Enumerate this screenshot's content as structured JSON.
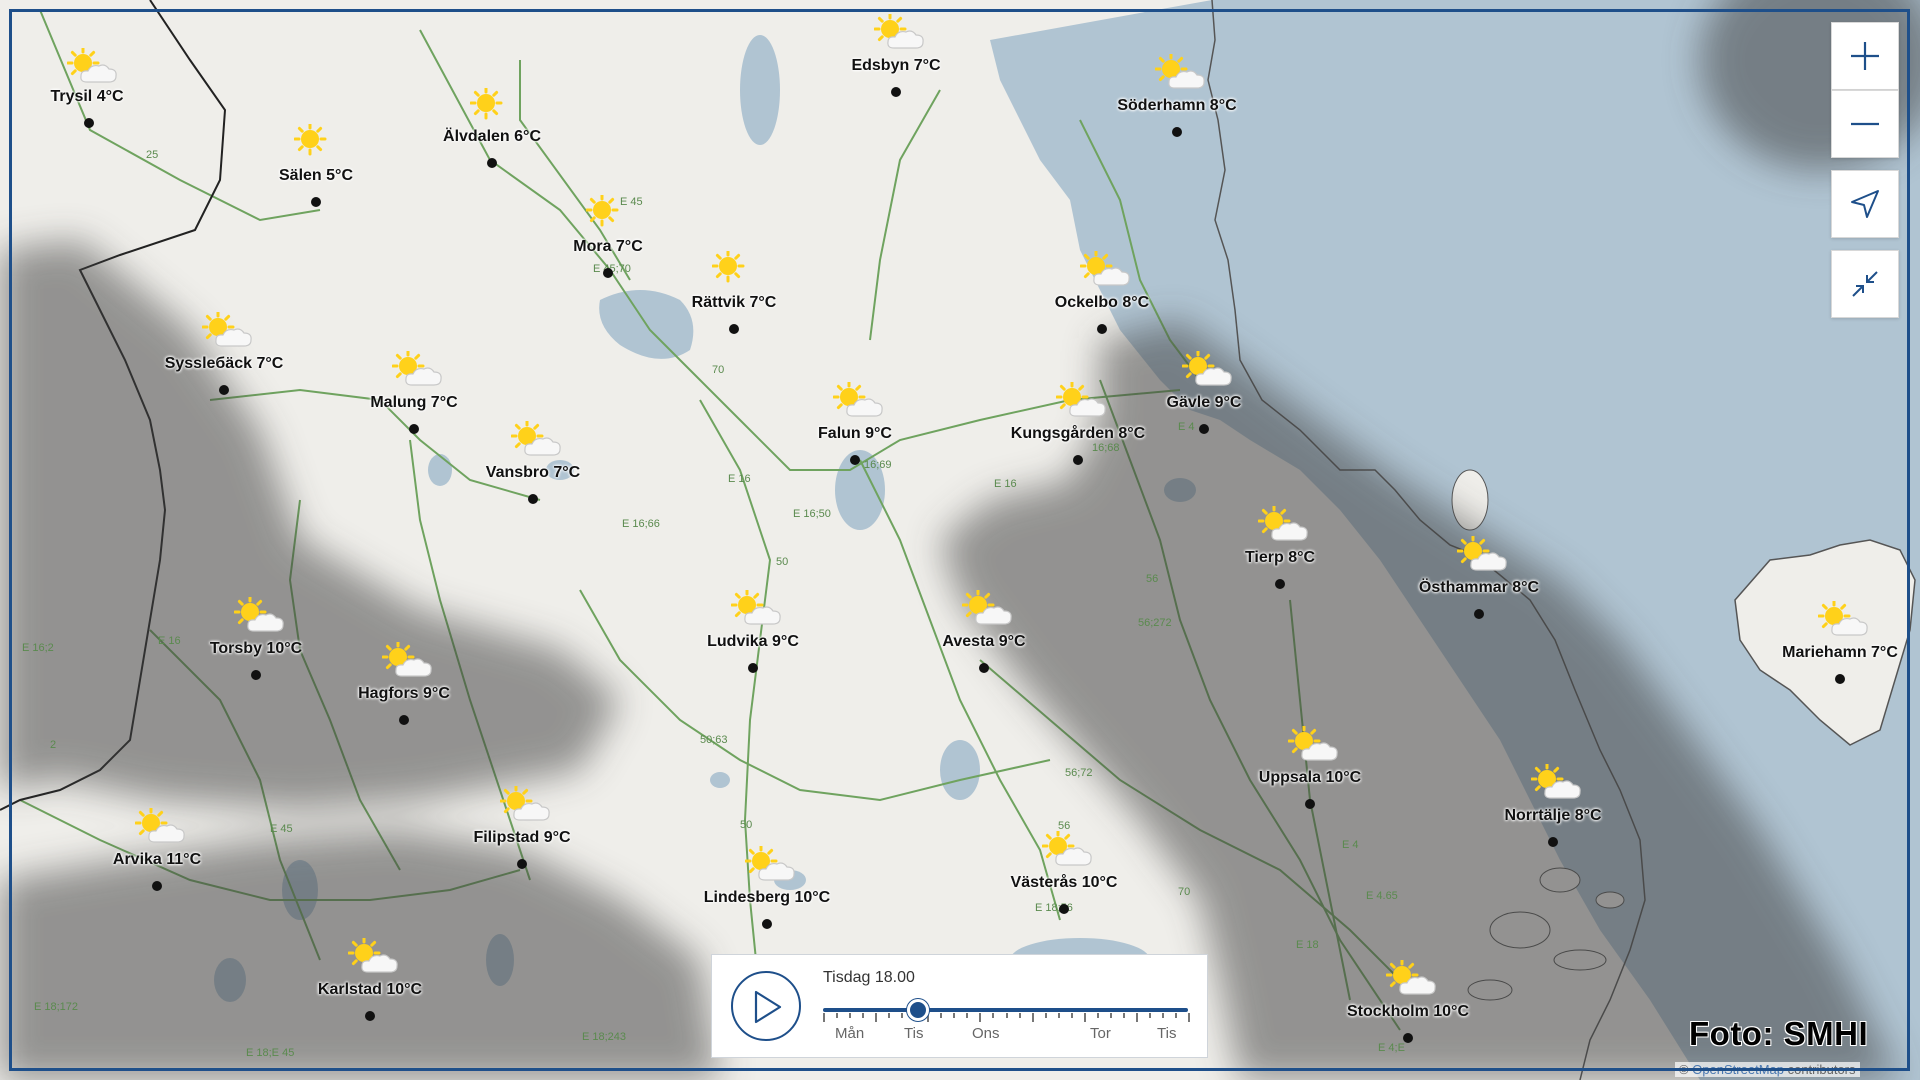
{
  "map": {
    "cities": [
      {
        "id": "trysil",
        "label": "Trysil 4°C",
        "icon": "sun-cloud-icon"
      },
      {
        "id": "alvdalen",
        "label": "Älvdalen 6°C",
        "icon": "sun-icon"
      },
      {
        "id": "salen",
        "label": "Sälen 5°C",
        "icon": "sun-icon"
      },
      {
        "id": "edsbyn",
        "label": "Edsbyn 7°C",
        "icon": "sun-cloud-icon"
      },
      {
        "id": "soderhamn",
        "label": "Söderhamn 8°C",
        "icon": "sun-cloud-icon"
      },
      {
        "id": "mora",
        "label": "Mora 7°C",
        "icon": "sun-icon"
      },
      {
        "id": "rattvik",
        "label": "Rättvik 7°C",
        "icon": "sun-icon"
      },
      {
        "id": "ockelbo",
        "label": "Ockelbo 8°C",
        "icon": "sun-cloud-icon"
      },
      {
        "id": "sysslebeck",
        "label": "Syssleбäck 7°C",
        "icon": "sun-cloud-icon"
      },
      {
        "id": "malung",
        "label": "Malung 7°C",
        "icon": "sun-cloud-icon"
      },
      {
        "id": "gavle",
        "label": "Gävle 9°C",
        "icon": "sun-cloud-icon"
      },
      {
        "id": "falun",
        "label": "Falun 9°C",
        "icon": "sun-cloud-icon"
      },
      {
        "id": "kungsgarden",
        "label": "Kungsgården 8°C",
        "icon": "sun-cloud-icon"
      },
      {
        "id": "vansbro",
        "label": "Vansbro 7°C",
        "icon": "sun-cloud-icon"
      },
      {
        "id": "tierp",
        "label": "Tierp 8°C",
        "icon": "sun-cloud-icon"
      },
      {
        "id": "osthammar",
        "label": "Östhammar 8°C",
        "icon": "sun-cloud-icon"
      },
      {
        "id": "mariehamn",
        "label": "Mariehamn 7°C",
        "icon": "sun-cloud-icon"
      },
      {
        "id": "torsby",
        "label": "Torsby 10°C",
        "icon": "sun-cloud-icon"
      },
      {
        "id": "ludvika",
        "label": "Ludvika 9°C",
        "icon": "sun-cloud-icon"
      },
      {
        "id": "avesta",
        "label": "Avesta 9°C",
        "icon": "sun-cloud-icon"
      },
      {
        "id": "hagfors",
        "label": "Hagfors 9°C",
        "icon": "sun-cloud-icon"
      },
      {
        "id": "uppsala",
        "label": "Uppsala 10°C",
        "icon": "sun-cloud-icon"
      },
      {
        "id": "norrtalje",
        "label": "Norrtälje 8°C",
        "icon": "sun-cloud-icon"
      },
      {
        "id": "arvika",
        "label": "Arvika 11°C",
        "icon": "sun-cloud-icon"
      },
      {
        "id": "filipstad",
        "label": "Filipstad 9°C",
        "icon": "sun-cloud-icon"
      },
      {
        "id": "lindesberg",
        "label": "Lindesberg 10°C",
        "icon": "sun-cloud-icon"
      },
      {
        "id": "vasteras",
        "label": "Västerås 10°C",
        "icon": "sun-cloud-icon"
      },
      {
        "id": "karlstad",
        "label": "Karlstad 10°C",
        "icon": "sun-cloud-icon"
      },
      {
        "id": "stockholm",
        "label": "Stockholm 10°C",
        "icon": "sun-cloud-icon"
      }
    ],
    "road_labels": [
      "25",
      "E 45",
      "E 45;70",
      "70",
      "E 16",
      "E 16;66",
      "E 16;50",
      "16;69",
      "16;68",
      "E 16",
      "50",
      "56",
      "56;272",
      "E 4",
      "E 16;2",
      "E 16",
      "2",
      "E 45",
      "50;63",
      "50",
      "56;72",
      "56",
      "E 18;56",
      "70",
      "E 4",
      "E 4.65",
      "E 18",
      "E 18;172",
      "E 18;E 45",
      "E 18;243",
      "E 4;E"
    ]
  },
  "controls": {
    "zoom_in_icon": "plus-icon",
    "zoom_out_icon": "minus-icon",
    "locate_icon": "navigation-arrow-icon",
    "collapse_icon": "collapse-arrows-icon"
  },
  "timeline": {
    "current_time": "Tisdag 18.00",
    "position": 0.26,
    "days": [
      "Mån",
      "Tis",
      "Ons",
      "Tor",
      "Tis"
    ]
  },
  "credit": "Foto: SMHI",
  "attribution": {
    "prefix": "© ",
    "link": "OpenStreetMap",
    "suffix": " contributors"
  },
  "colors": {
    "water": "#b0c4d2",
    "land": "#efeeea",
    "cloud_overlay": "#4a4a4a",
    "accent": "#1e4f8a",
    "road": "#6fa35f",
    "border": "#222222"
  }
}
